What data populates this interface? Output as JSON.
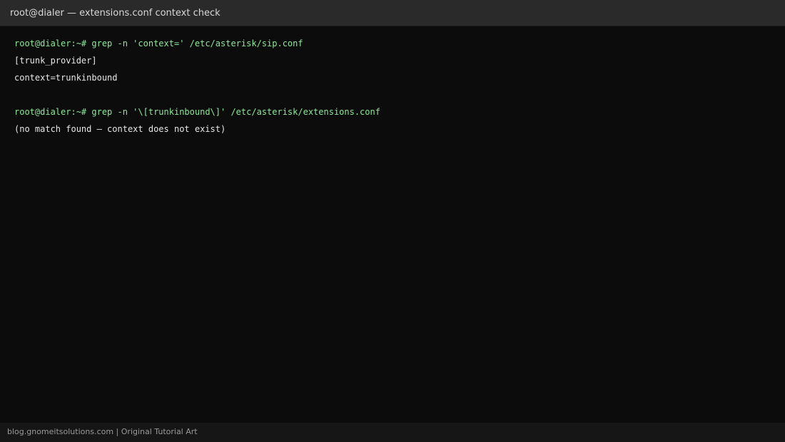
{
  "window": {
    "title": "root@dialer — extensions.conf context check"
  },
  "terminal": {
    "block1": {
      "prompt": "root@dialer:~#",
      "command": " grep -n 'context=' /etc/asterisk/sip.conf",
      "output": [
        "[trunk_provider]",
        "context=trunkinbound"
      ]
    },
    "block2": {
      "prompt": "root@dialer:~#",
      "command": " grep -n '\\[trunkinbound\\]' /etc/asterisk/extensions.conf",
      "output": [
        "(no match found — context does not exist)"
      ]
    }
  },
  "footer": {
    "text": "blog.gnomeitsolutions.com | Original Tutorial Art"
  },
  "colors": {
    "background": "#0c0c0c",
    "titlebar": "#2a2a2a",
    "prompt_green": "#8ee89b",
    "output_text": "#e6e6e6",
    "footer_bg": "#161616",
    "footer_text": "#9a9a9a"
  }
}
